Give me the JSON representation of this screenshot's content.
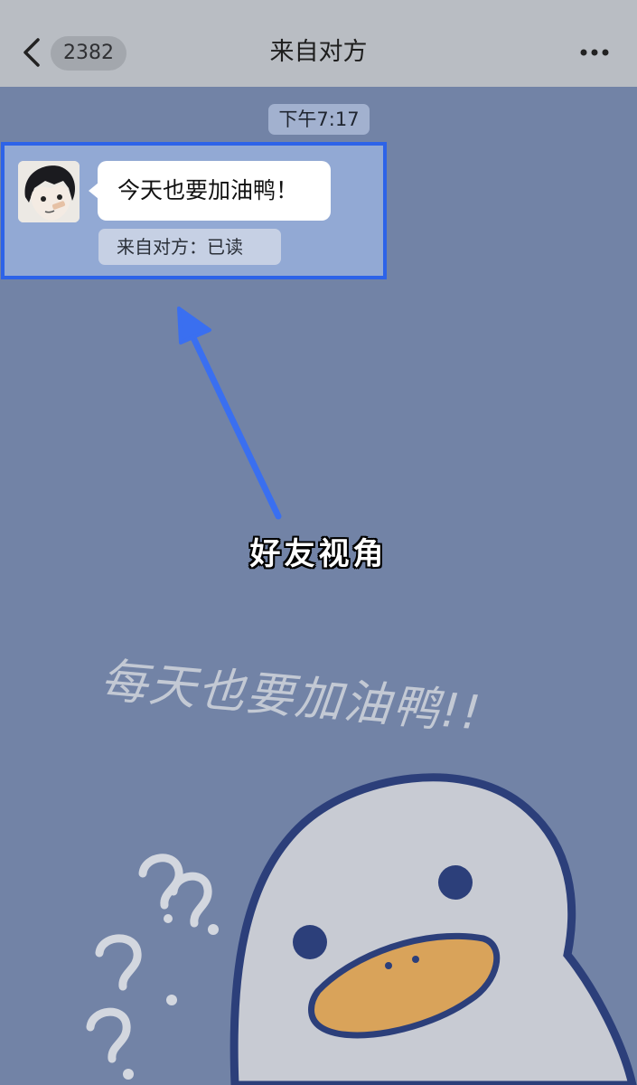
{
  "colors": {
    "header_bg": "#b9bdc3",
    "chat_bg": "#7283a6",
    "highlight_border": "#2d63e8",
    "arrow": "#3a6ff0",
    "duck_beak": "#d9a35a"
  },
  "header": {
    "back_icon": "chevron-left-icon",
    "unread_count": "2382",
    "title": "来自对方",
    "more_icon": "more-dots-icon"
  },
  "chat": {
    "timestamp": "下午7:17",
    "message": {
      "text": "今天也要加油鸭！",
      "read_status": "来自对方：已读"
    }
  },
  "annotation": {
    "caption": "好友视角"
  },
  "wallpaper": {
    "text": "每天也要加油鸭!!",
    "question_marks": [
      "?",
      "?",
      "?",
      "?"
    ]
  }
}
